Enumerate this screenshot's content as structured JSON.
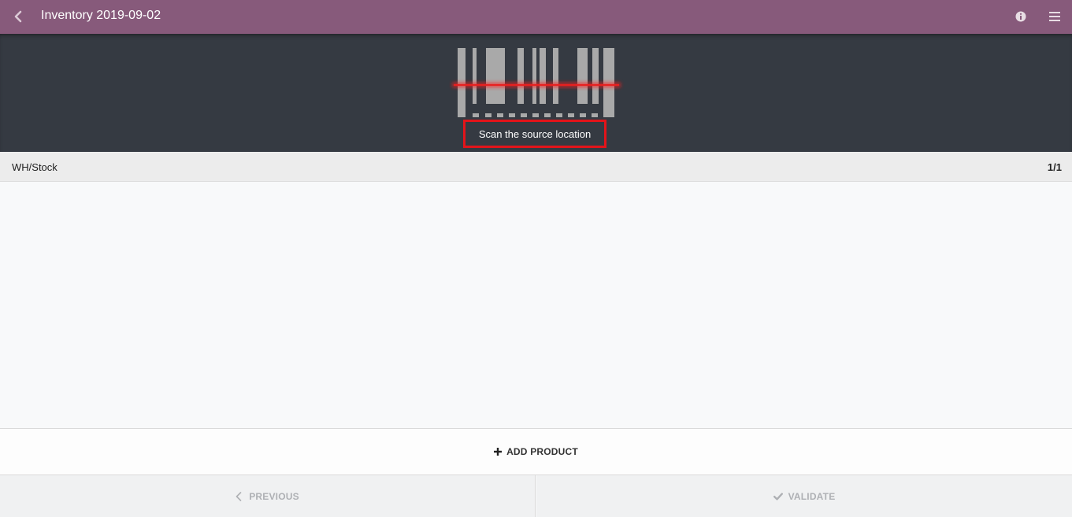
{
  "header": {
    "title": "Inventory 2019-09-02",
    "back_icon": "chevron-left-icon",
    "info_icon": "info-icon",
    "menu_icon": "hamburger-menu-icon",
    "bg_color": "#875a7b"
  },
  "scanner": {
    "message": "Scan the source location",
    "highlight_color": "#e3141a",
    "bg_color": "#353a42"
  },
  "location": {
    "name": "WH/Stock",
    "count": "1/1"
  },
  "actions": {
    "add_product": "ADD PRODUCT",
    "previous": "PREVIOUS",
    "validate": "VALIDATE"
  }
}
